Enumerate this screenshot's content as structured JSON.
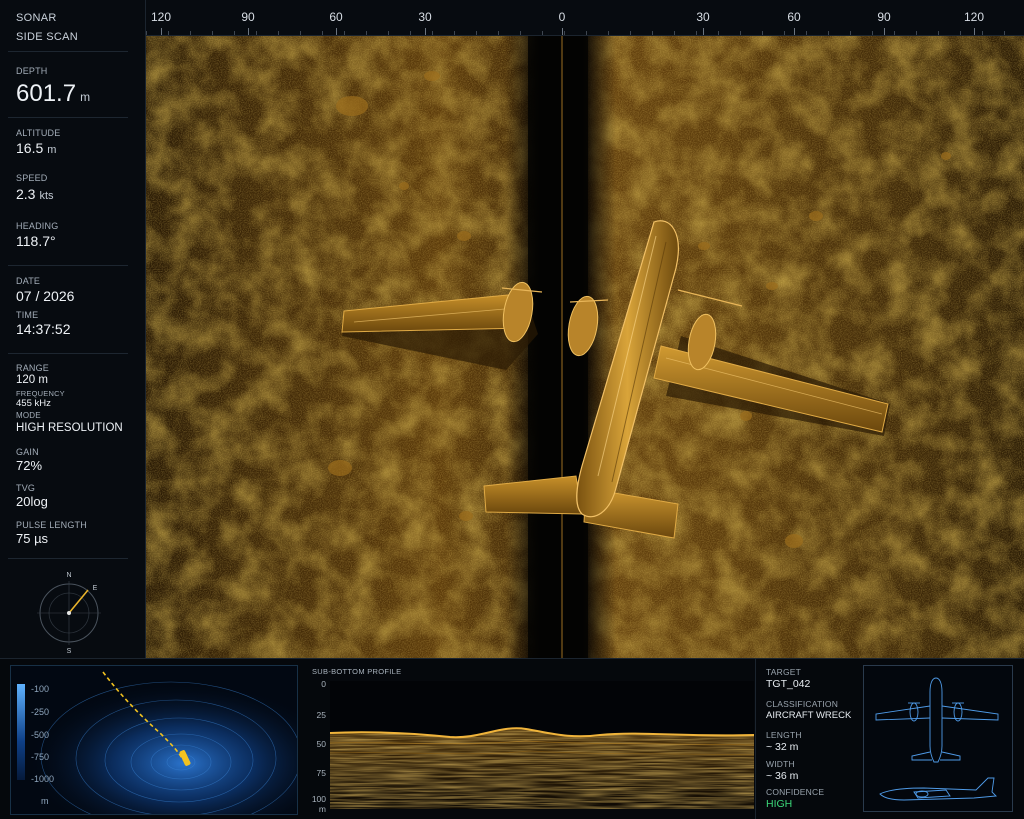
{
  "app": {
    "title": "SONAR",
    "mode": "SIDE SCAN"
  },
  "telemetry": {
    "depth": {
      "label": "DEPTH",
      "value": "601.7",
      "unit": "m"
    },
    "altitude": {
      "label": "ALTITUDE",
      "value": "16.5",
      "unit": "m"
    },
    "speed": {
      "label": "SPEED",
      "value": "2.3",
      "unit": "kts"
    },
    "heading": {
      "label": "HEADING",
      "value": "118.7°"
    }
  },
  "datetime": {
    "date_label": "DATE",
    "date": "07 / 2026",
    "time_label": "TIME",
    "time": "14:37:52"
  },
  "settings": {
    "range_label": "RANGE",
    "range": "120 m",
    "frequency_label": "FREQUENCY",
    "frequency": "455 kHz",
    "mode_label": "MODE",
    "mode": "HIGH RESOLUTION",
    "gain_label": "GAIN",
    "gain": "72%",
    "tvg_label": "TVG",
    "tvg": "20log",
    "pulse_label": "PULSE LENGTH",
    "pulse": "75 µs"
  },
  "compass": {
    "n": "N",
    "s": "S",
    "e": "E",
    "heading_deg": 118.7
  },
  "scale": {
    "left": [
      "120",
      "90",
      "60",
      "30"
    ],
    "center": "0",
    "right": [
      "30",
      "60",
      "90",
      "120"
    ]
  },
  "bathymetry": {
    "legend": [
      "-100",
      "-250",
      "-500",
      "-750",
      "-1000"
    ],
    "unit": "m"
  },
  "profile": {
    "title": "SUB-BOTTOM PROFILE",
    "ticks": [
      "0",
      "25",
      "50",
      "75",
      "100"
    ],
    "unit": "m"
  },
  "target": {
    "target_label": "TARGET",
    "target": "TGT_042",
    "class_label": "CLASSIFICATION",
    "class": "AIRCRAFT WRECK",
    "length_label": "LENGTH",
    "length": "~ 32 m",
    "width_label": "WIDTH",
    "width": "~ 36 m",
    "conf_label": "CONFIDENCE",
    "conf": "HIGH"
  },
  "colors": {
    "sonar": "#b98314",
    "seabed": "#3a2507",
    "confidence": "#3cd97a",
    "bathy": "#2f7fe0"
  }
}
